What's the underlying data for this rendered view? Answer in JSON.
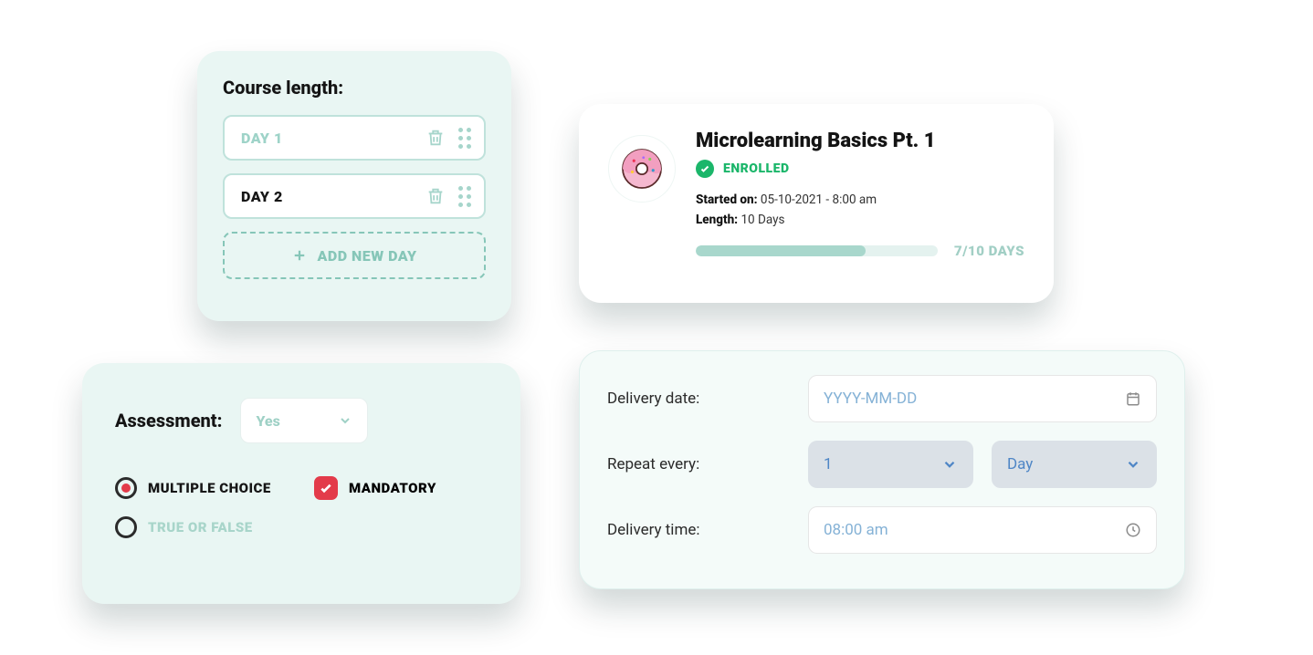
{
  "course_length": {
    "title": "Course length:",
    "days": [
      {
        "label": "DAY 1",
        "selected": true
      },
      {
        "label": "DAY 2",
        "selected": false
      }
    ],
    "add_label": "ADD NEW DAY"
  },
  "enrolled_card": {
    "title": "Microlearning Basics Pt. 1",
    "status": "ENROLLED",
    "started_label": "Started on:",
    "started_value": "05-10-2021 - 8:00 am",
    "length_label": "Length:",
    "length_value": "10 Days",
    "progress_label": "7/10 DAYS",
    "progress_percent": 70
  },
  "assessment": {
    "title": "Assessment:",
    "dropdown_value": "Yes",
    "options": {
      "multiple_choice": "MULTIPLE CHOICE",
      "true_or_false": "TRUE OR FALSE",
      "mandatory": "MANDATORY"
    }
  },
  "delivery": {
    "date_label": "Delivery date:",
    "date_placeholder": "YYYY-MM-DD",
    "repeat_label": "Repeat every:",
    "repeat_count": "1",
    "repeat_unit": "Day",
    "time_label": "Delivery time:",
    "time_value": "08:00 am"
  }
}
